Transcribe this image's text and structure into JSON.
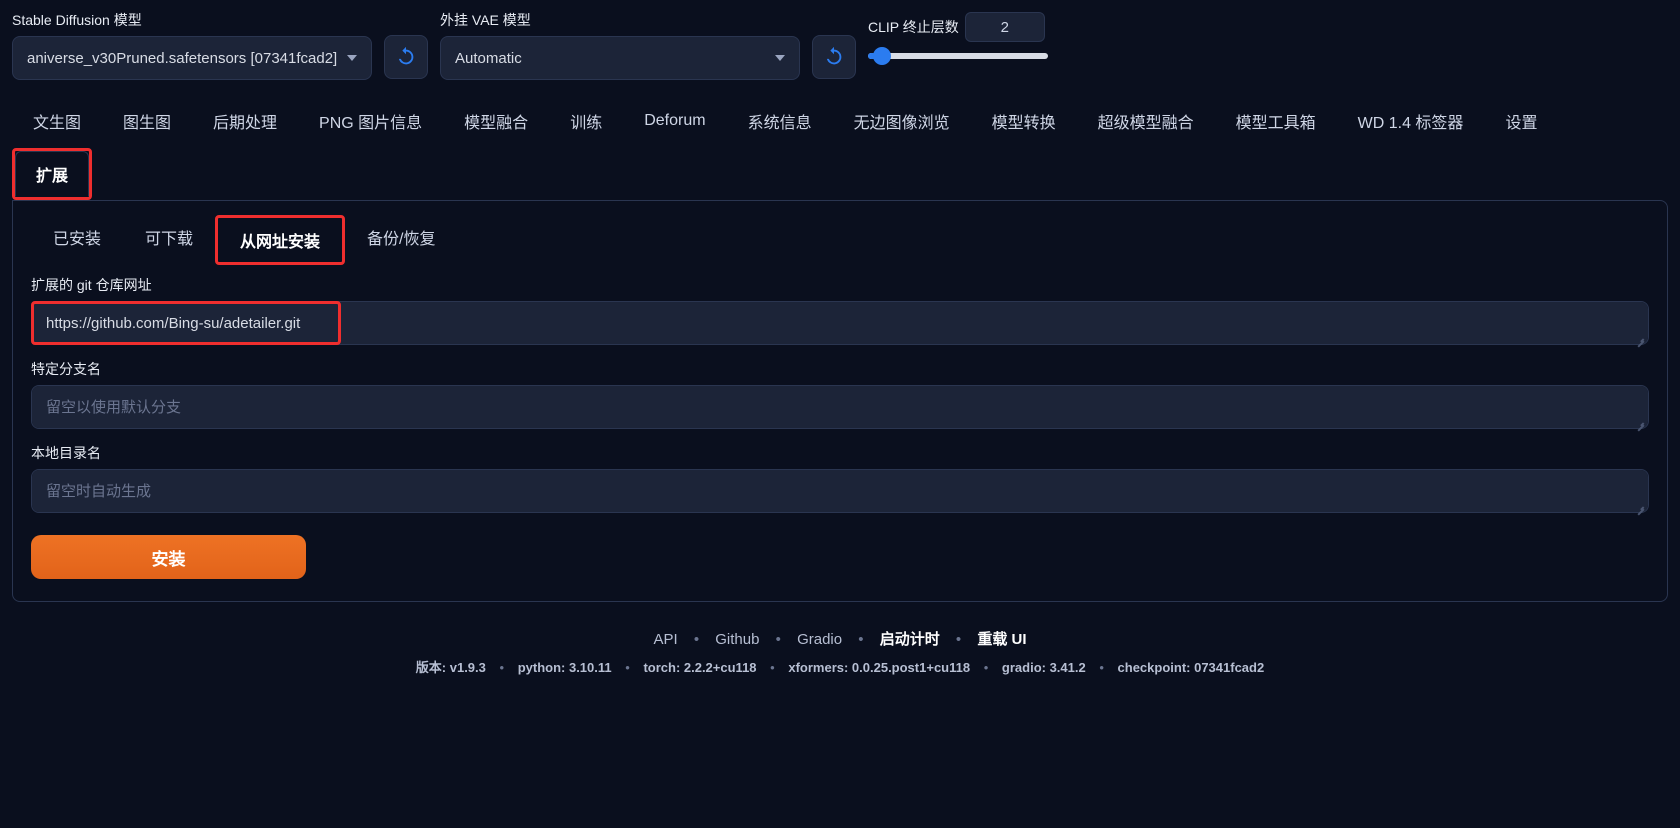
{
  "header": {
    "sd_model_label": "Stable Diffusion 模型",
    "sd_model_value": "aniverse_v30Pruned.safetensors [07341fcad2]",
    "vae_label": "外挂 VAE 模型",
    "vae_value": "Automatic",
    "clip_label": "CLIP 终止层数",
    "clip_value": "2"
  },
  "tabs": {
    "items": [
      "文生图",
      "图生图",
      "后期处理",
      "PNG 图片信息",
      "模型融合",
      "训练",
      "Deforum",
      "系统信息",
      "无边图像浏览",
      "模型转换",
      "超级模型融合",
      "模型工具箱",
      "WD 1.4 标签器",
      "设置",
      "扩展"
    ],
    "active": "扩展"
  },
  "subtabs": {
    "items": [
      "已安装",
      "可下载",
      "从网址安装",
      "备份/恢复"
    ],
    "active": "从网址安装"
  },
  "form": {
    "repo_label": "扩展的 git 仓库网址",
    "repo_value": "https://github.com/Bing-su/adetailer.git",
    "branch_label": "特定分支名",
    "branch_placeholder": "留空以使用默认分支",
    "localdir_label": "本地目录名",
    "localdir_placeholder": "留空时自动生成",
    "install_label": "安装"
  },
  "footer": {
    "links": {
      "api": "API",
      "github": "Github",
      "gradio": "Gradio",
      "startup": "启动计时",
      "reload": "重载 UI"
    },
    "version": {
      "prefix": "版本:",
      "ver": "v1.9.3",
      "python": "python: 3.10.11",
      "torch": "torch: 2.2.2+cu118",
      "xformers": "xformers: 0.0.25.post1+cu118",
      "gradio": "gradio: 3.41.2",
      "checkpoint": "checkpoint: 07341fcad2"
    }
  }
}
